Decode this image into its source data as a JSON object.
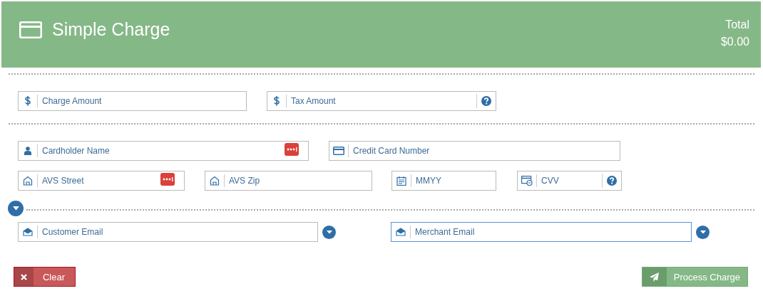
{
  "header": {
    "title": "Simple Charge",
    "total_label": "Total",
    "total_value": "$0.00"
  },
  "sections": [
    {
      "rows": [
        [
          {
            "placeholder": "Charge Amount",
            "kind": "amount",
            "focused": false
          },
          {
            "placeholder": "Tax Amount",
            "kind": "tax",
            "focused": false
          }
        ]
      ]
    },
    {
      "rows": [
        [
          {
            "placeholder": "Cardholder Name",
            "kind": "name",
            "focused": false
          },
          {
            "placeholder": "Credit Card Number",
            "kind": "card",
            "focused": false
          }
        ],
        [
          {
            "placeholder": "AVS Street",
            "kind": "street",
            "focused": false
          },
          {
            "placeholder": "AVS Zip",
            "kind": "zip",
            "focused": false
          },
          {
            "placeholder": "MMYY",
            "kind": "expiry",
            "focused": false
          },
          {
            "placeholder": "CVV",
            "kind": "cvv",
            "focused": false
          }
        ]
      ]
    }
  ],
  "emails": {
    "expanded": false,
    "fields": [
      {
        "placeholder": "Customer Email",
        "kind": "email",
        "focused": false
      },
      {
        "placeholder": "Merchant Email",
        "kind": "email",
        "focused": true
      }
    ]
  },
  "buttons": [
    {
      "kind": "clear",
      "label": "Clear"
    },
    {
      "kind": "process",
      "label": "Process Charge"
    }
  ]
}
